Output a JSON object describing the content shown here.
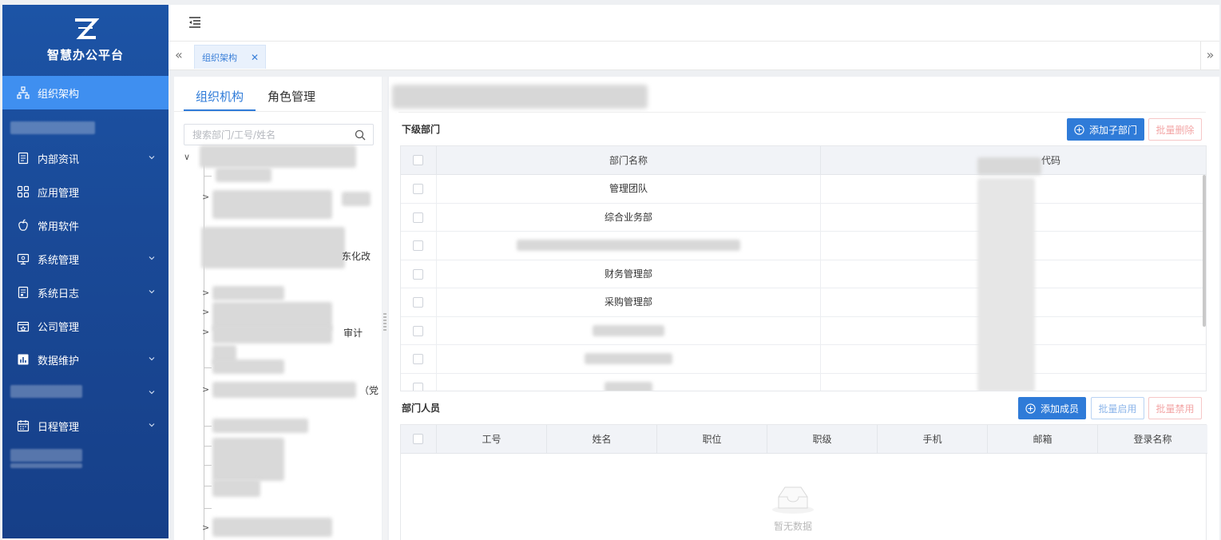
{
  "app": {
    "title": "智慧办公平台"
  },
  "sidebar": {
    "items": [
      {
        "label": "组织架构",
        "icon": "org-chart-icon",
        "active": true
      },
      {
        "label": "内部资讯",
        "icon": "document-icon",
        "expandable": true
      },
      {
        "label": "应用管理",
        "icon": "grid-icon"
      },
      {
        "label": "常用软件",
        "icon": "apple-icon"
      },
      {
        "label": "系统管理",
        "icon": "monitor-settings-icon",
        "expandable": true
      },
      {
        "label": "系统日志",
        "icon": "log-icon",
        "expandable": true
      },
      {
        "label": "公司管理",
        "icon": "company-icon"
      },
      {
        "label": "数据维护",
        "icon": "bar-chart-icon",
        "expandable": true
      },
      {
        "label": "日程管理",
        "icon": "calendar-icon",
        "expandable": true
      }
    ]
  },
  "tabs": [
    {
      "label": "组织架构",
      "closable": true
    }
  ],
  "left_panel": {
    "tabs": [
      {
        "label": "组织机构",
        "active": true
      },
      {
        "label": "角色管理"
      }
    ],
    "search_placeholder": "搜索部门/工号/姓名",
    "visible_tree_fragments": [
      "（",
      "东化改",
      "审计",
      "（党"
    ]
  },
  "sub_departments": {
    "label": "下级部门",
    "add_button": "添加子部门",
    "batch_delete_button": "批量删除",
    "columns": [
      "部门名称",
      "代码"
    ],
    "rows": [
      "管理团队",
      "综合业务部",
      "",
      "财务管理部",
      "采购管理部",
      "",
      "",
      ""
    ]
  },
  "members": {
    "label": "部门人员",
    "add_button": "添加成员",
    "batch_enable_button": "批量启用",
    "batch_disable_button": "批量禁用",
    "columns": [
      "工号",
      "姓名",
      "职位",
      "职级",
      "手机",
      "邮箱",
      "登录名称"
    ],
    "empty_text": "暂无数据"
  },
  "colors": {
    "sidebar": "#1a4a98",
    "accent": "#2f7bd8",
    "active_menu": "#3f8ff0",
    "danger_light": "#f3a6a6"
  }
}
